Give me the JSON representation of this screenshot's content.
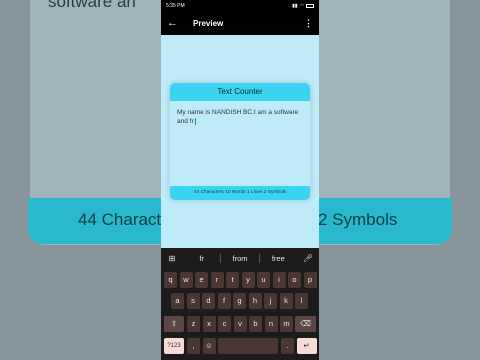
{
  "background": {
    "top_text": "software an",
    "stats_left": "44 Characte",
    "stats_right": "2 Symbols"
  },
  "status_bar": {
    "time": "5:35 PM"
  },
  "app_bar": {
    "title": "Preview"
  },
  "card": {
    "title": "Text Counter",
    "text": "My name is NANDISH BC.I am a software and fr",
    "stats": "44 Characters 10 Words 1 Lines 2 Symbols"
  },
  "keyboard": {
    "suggestions": [
      "fr",
      "from",
      "free"
    ],
    "row1": [
      "q",
      "w",
      "e",
      "r",
      "t",
      "y",
      "u",
      "i",
      "o",
      "p"
    ],
    "row1_hints": [
      "1",
      "2",
      "3",
      "4",
      "5",
      "6",
      "7",
      "8",
      "9",
      "0"
    ],
    "row2": [
      "a",
      "s",
      "d",
      "f",
      "g",
      "h",
      "j",
      "k",
      "l"
    ],
    "row3": [
      "z",
      "x",
      "c",
      "v",
      "b",
      "n",
      "m"
    ],
    "sym_label": "?123",
    "comma_label": ",",
    "period_label": ".",
    "shift_icon": "shift-icon",
    "backspace_icon": "backspace-icon",
    "enter_icon": "enter-icon",
    "emoji_icon": "emoji-icon",
    "mic_icon": "mic-icon",
    "grid_icon": "grid-icon"
  },
  "colors": {
    "accent": "#3ad4f0",
    "screen_bg": "#bfeaf8",
    "key_bg": "#4a3633",
    "action_key_bg": "#f6dcd6"
  }
}
